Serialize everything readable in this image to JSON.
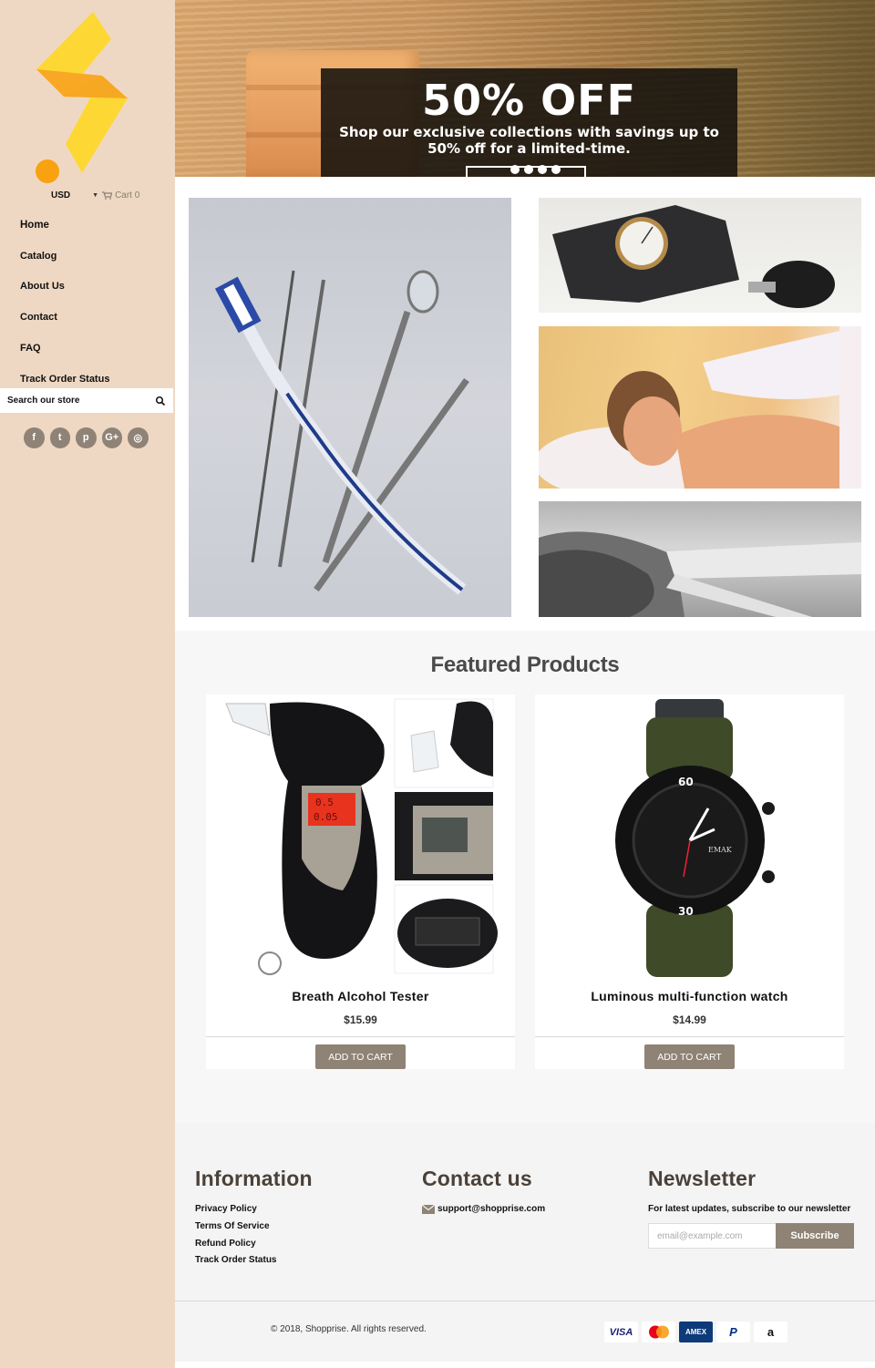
{
  "sidebar": {
    "currency": "USD",
    "cart_label": "Cart 0",
    "nav": [
      "Home",
      "Catalog",
      "About Us",
      "Contact",
      "FAQ",
      "Track Order Status"
    ],
    "search_placeholder": "Search our store",
    "socials": [
      {
        "name": "facebook",
        "glyph": "f"
      },
      {
        "name": "twitter",
        "glyph": "t"
      },
      {
        "name": "pinterest",
        "glyph": "p"
      },
      {
        "name": "google-plus",
        "glyph": "G+"
      },
      {
        "name": "instagram",
        "glyph": "◎"
      }
    ]
  },
  "hero": {
    "headline": "50% OFF",
    "subtext": "Shop our exclusive collections with savings up to 50% off for a limited-time.",
    "slide_count": 4
  },
  "collage": {
    "tiles": [
      "Dental care tools",
      "Blood pressure monitor",
      "Massage therapy",
      "Measuring tape"
    ]
  },
  "featured": {
    "title": "Featured Products",
    "products": [
      {
        "title": "Breath Alcohol Tester",
        "price": "$15.99",
        "button": "ADD TO CART",
        "lcd_top": "0.5",
        "lcd_bottom": "0.05"
      },
      {
        "title": "Luminous multi-function watch",
        "price": "$14.99",
        "button": "ADD TO CART",
        "watch_brand": "EMAK"
      }
    ]
  },
  "footer": {
    "info": {
      "title": "Information",
      "links": [
        "Privacy Policy",
        "Terms Of Service",
        "Refund Policy",
        "Track Order Status"
      ]
    },
    "contact": {
      "title": "Contact us",
      "email": "support@shopprise.com"
    },
    "newsletter": {
      "title": "Newsletter",
      "text": "For latest updates, subscribe to our newsletter",
      "placeholder": "email@example.com",
      "button": "Subscribe"
    },
    "copyright": "© 2018, Shopprise. All rights reserved.",
    "payments": [
      "VISA",
      "Mastercard",
      "AMEX",
      "P",
      "a"
    ]
  },
  "colors": {
    "sidebar_bg": "#efd8c3",
    "accent": "#8f8375",
    "heading": "#4b4138",
    "logo_yellow": "#fdd835",
    "logo_orange": "#f9a825"
  }
}
